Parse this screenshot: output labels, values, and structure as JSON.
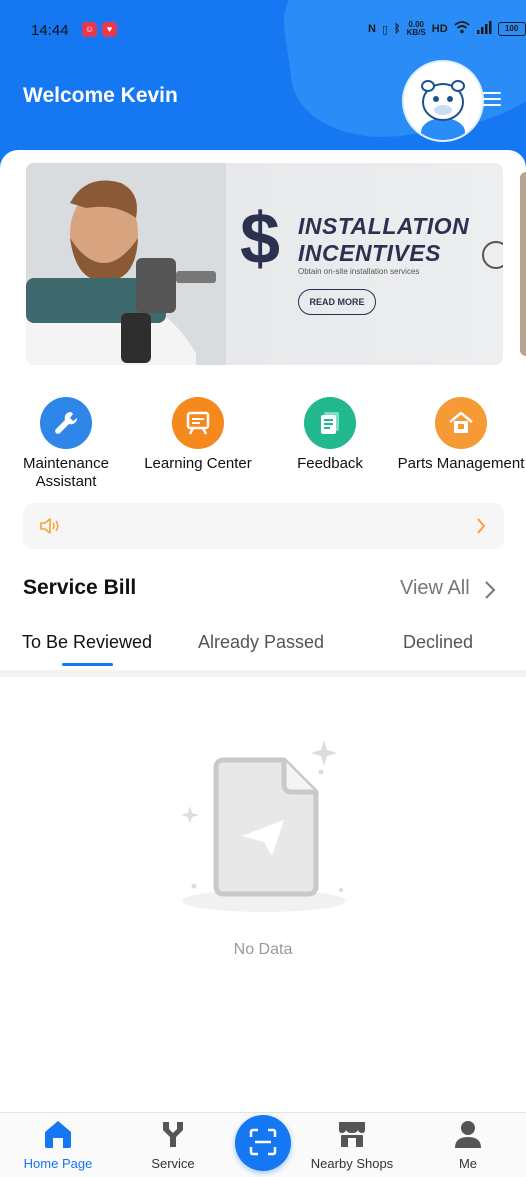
{
  "status_bar": {
    "time": "14:44",
    "net_speed": "0.00\nKB/S",
    "hd": "HD",
    "signal": "5G",
    "battery": "100"
  },
  "header": {
    "welcome": "Welcome Kevin"
  },
  "banner": {
    "title_line1": "INSTALLATION",
    "title_line2": "INCENTIVES",
    "subtitle": "Obtain on-site installation services",
    "read_more": "READ MORE"
  },
  "quick_actions": [
    {
      "label": "Maintenance Assistant",
      "color": "#2e86e8",
      "icon": "wrench-icon"
    },
    {
      "label": "Learning Center",
      "color": "#f5891e",
      "icon": "board-icon"
    },
    {
      "label": "Feedback",
      "color": "#21b88e",
      "icon": "document-icon"
    },
    {
      "label": "Parts Management",
      "color": "#f59a34",
      "icon": "house-icon"
    }
  ],
  "service_bill": {
    "title": "Service Bill",
    "view_all": "View All",
    "tabs": [
      {
        "label": "To Be Reviewed",
        "active": true
      },
      {
        "label": "Already Passed",
        "active": false
      },
      {
        "label": "Declined",
        "active": false
      }
    ],
    "empty_text": "No Data"
  },
  "bottom_nav": [
    {
      "label": "Home Page",
      "icon": "home-icon",
      "active": true
    },
    {
      "label": "Service",
      "icon": "service-icon",
      "active": false
    },
    {
      "label": "",
      "icon": "scan-icon",
      "active": false
    },
    {
      "label": "Nearby Shops",
      "icon": "shop-icon",
      "active": false
    },
    {
      "label": "Me",
      "icon": "person-icon",
      "active": false
    }
  ],
  "colors": {
    "primary": "#1677f2",
    "notice_accent": "#f5a43a"
  }
}
